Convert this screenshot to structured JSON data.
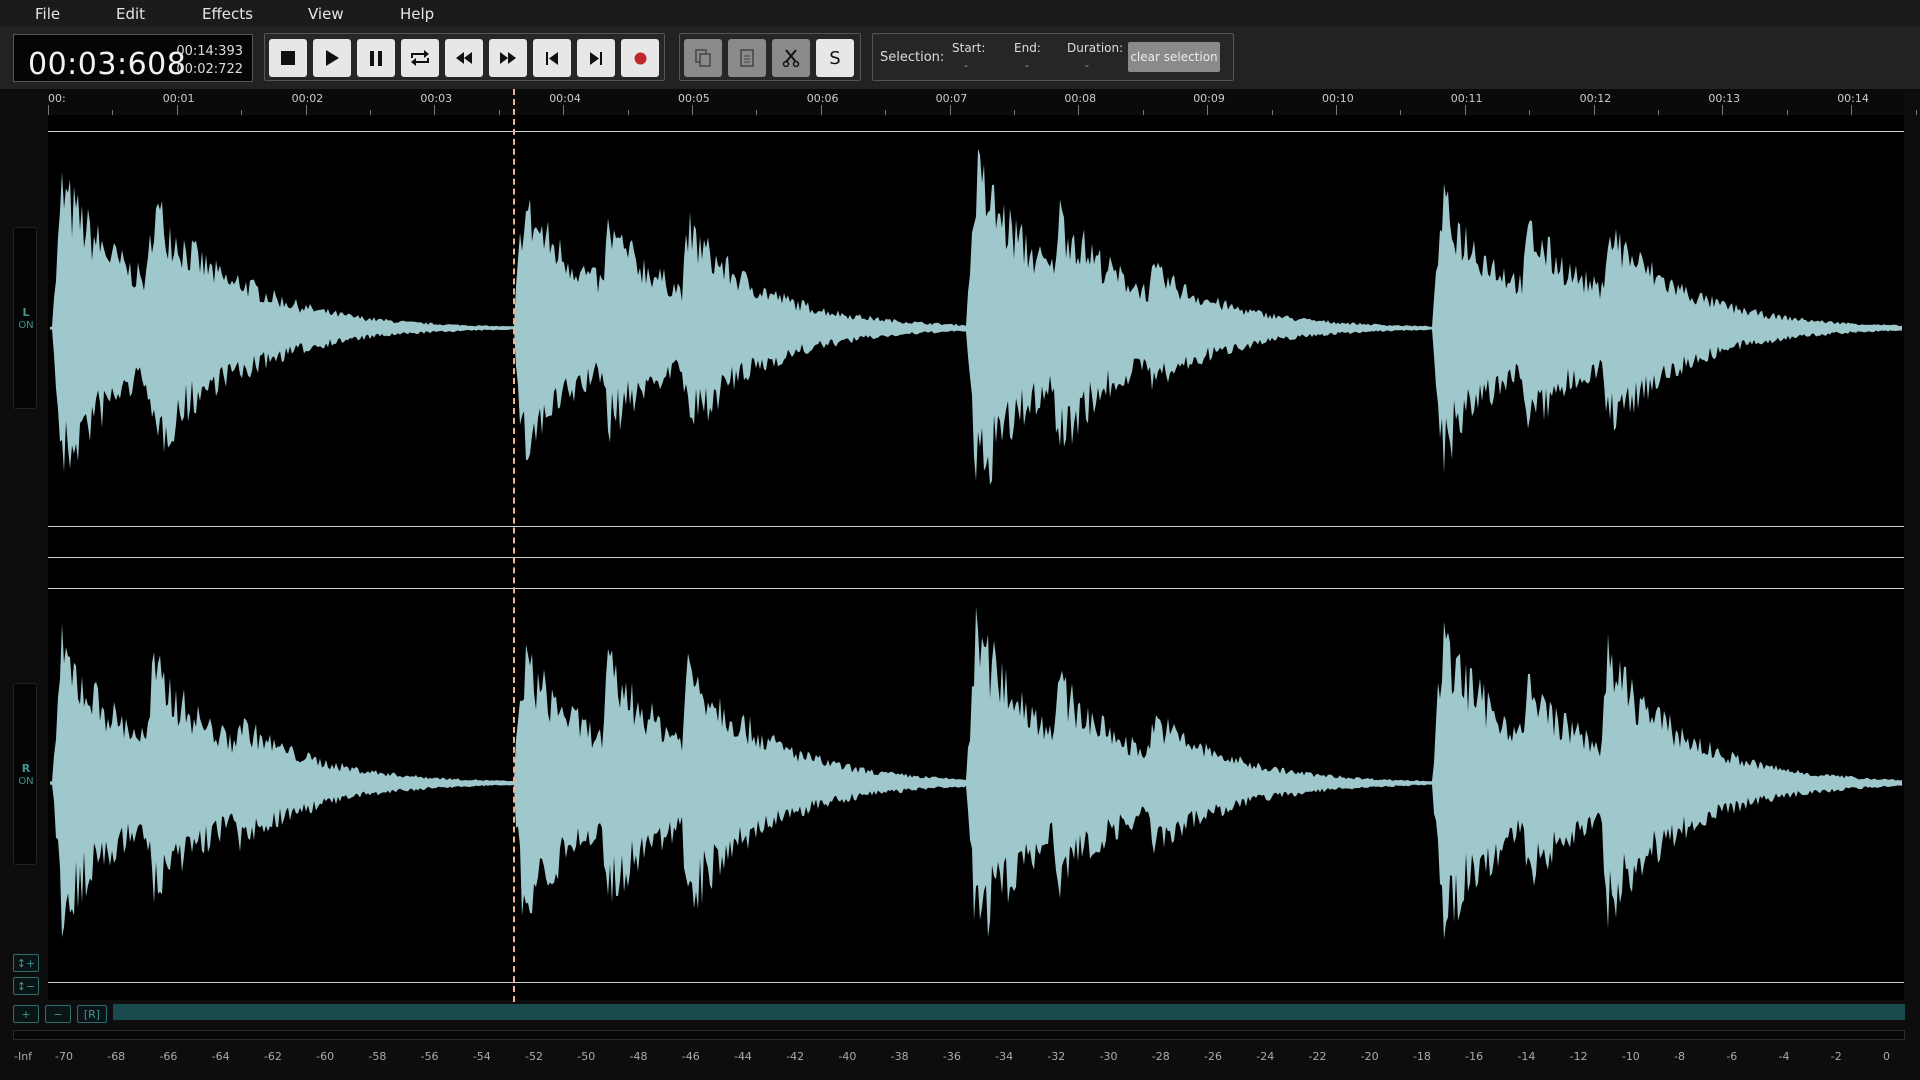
{
  "menu": [
    "File",
    "Edit",
    "Effects",
    "View",
    "Help"
  ],
  "time": {
    "current": "00:03:608",
    "total": "00:14:393",
    "selection": "00:02:722"
  },
  "transport": {
    "stop": "stop-icon",
    "play": "play-icon",
    "pause": "pause-icon",
    "loop": "loop-icon",
    "rewind": "rewind-icon",
    "fast_forward": "fast-forward-icon",
    "skip_start": "skip-to-start-icon",
    "skip_end": "skip-to-end-icon",
    "record": "record-icon"
  },
  "edit_tools": {
    "copy": "copy-icon",
    "paste": "paste-icon",
    "cut": "scissors-icon",
    "silence_label": "S"
  },
  "selection": {
    "label": "Selection:",
    "start_label": "Start:",
    "start_value": "-",
    "end_label": "End:",
    "end_value": "-",
    "duration_label": "Duration:",
    "duration_value": "-",
    "clear_label": "clear selection"
  },
  "timeline": [
    "00:",
    "00:01",
    "00:02",
    "00:03",
    "00:04",
    "00:05",
    "00:06",
    "00:07",
    "00:08",
    "00:09",
    "00:10",
    "00:11",
    "00:12",
    "00:13",
    "00:14"
  ],
  "channels": [
    {
      "name": "L",
      "state": "ON"
    },
    {
      "name": "R",
      "state": "ON"
    }
  ],
  "playhead_seconds": 3.608,
  "duration_seconds": 14.393,
  "zoom_buttons": {
    "vzoom_in": "↕+",
    "vzoom_out": "↕−",
    "hzoom_in": "+",
    "hzoom_out": "−",
    "reset": "[R]"
  },
  "meter_labels": [
    "-Inf",
    "-70",
    "-68",
    "-66",
    "-64",
    "-62",
    "-60",
    "-58",
    "-56",
    "-54",
    "-52",
    "-50",
    "-48",
    "-46",
    "-44",
    "-42",
    "-40",
    "-38",
    "-36",
    "-34",
    "-32",
    "-30",
    "-28",
    "-26",
    "-24",
    "-22",
    "-20",
    "-18",
    "-16",
    "-14",
    "-12",
    "-10",
    "-8",
    "-6",
    "-4",
    "-2",
    "0"
  ],
  "colors": {
    "waveform": "#9ec8cc",
    "playhead": "#f0b48c",
    "accent": "#3f9696",
    "record": "#c0262b"
  }
}
